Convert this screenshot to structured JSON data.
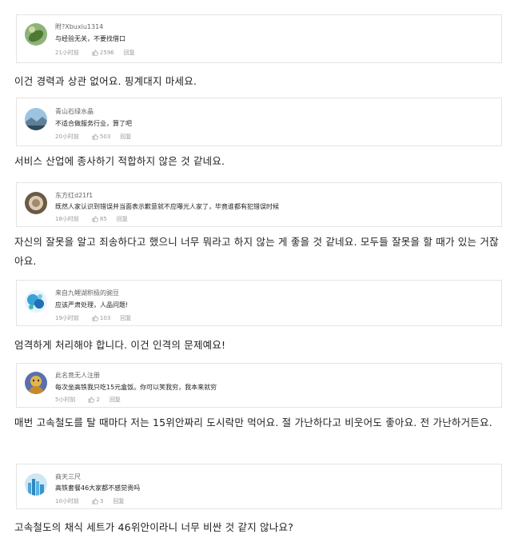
{
  "comments": [
    {
      "username": "附?Xbuxiu1314",
      "text": "与经验无关，不要找借口",
      "time": "21小时前",
      "likes": "2596",
      "reply_label": "回复",
      "avatar_icon": "green-leaf-avatar-icon",
      "translation": "이건 경력과 상관 없어요. 핑계대지 마세요."
    },
    {
      "username": "青山石绿水晶",
      "text": "不适合做服务行业，算了吧",
      "time": "20小时前",
      "likes": "503",
      "reply_label": "回复",
      "avatar_icon": "landscape-avatar-icon",
      "translation": "서비스 산업에 종사하기 적합하지 않은 것 같네요."
    },
    {
      "username": "东方红d21f1",
      "text": "既然人家认识到错误并当面表示歉意就不应曝光人家了，毕竟谁都有犯错误时候",
      "time": "18小时前",
      "likes": "85",
      "reply_label": "回复",
      "avatar_icon": "brown-circle-avatar-icon",
      "translation": "자신의 잘못을 알고 죄송하다고 했으니 너무 뭐라고 하지 않는 게 좋을 것 같네요. 모두들 잘못을 할 때가 있는 거잖아요."
    },
    {
      "username": "来自九鲤湖积极的豌豆",
      "text": "应该严肃处理，人品问题!",
      "time": "19小时前",
      "likes": "103",
      "reply_label": "回复",
      "avatar_icon": "blue-bubbles-avatar-icon",
      "translation": "엄격하게 처리해야 합니다. 이건 인격의 문제예요!"
    },
    {
      "username": "此名竟无人注册",
      "text": "每次坐高铁我只吃15元盒饭。你可以笑我穷，我本来就穷",
      "time": "5小时前",
      "likes": "2",
      "reply_label": "回复",
      "avatar_icon": "cartoon-avatar-icon",
      "translation": "매번 고속철도를 탈 때마다 저는 15위안짜리 도시락만 먹어요. 절 가난하다고 비웃어도 좋아요. 전 가난하거든요."
    },
    {
      "username": "商天三尺",
      "text": "高铁套餐46大家都不感觉贵吗",
      "time": "10小时前",
      "likes": "3",
      "reply_label": "回复",
      "avatar_icon": "city-skyline-avatar-icon",
      "translation": "고속철도의 채식 세트가 46위안이라니 너무 비싼 것 같지 않나요?"
    }
  ],
  "colors": {
    "card_border": "#e4e4e4",
    "meta_text": "#999999",
    "username_text": "#666666"
  }
}
